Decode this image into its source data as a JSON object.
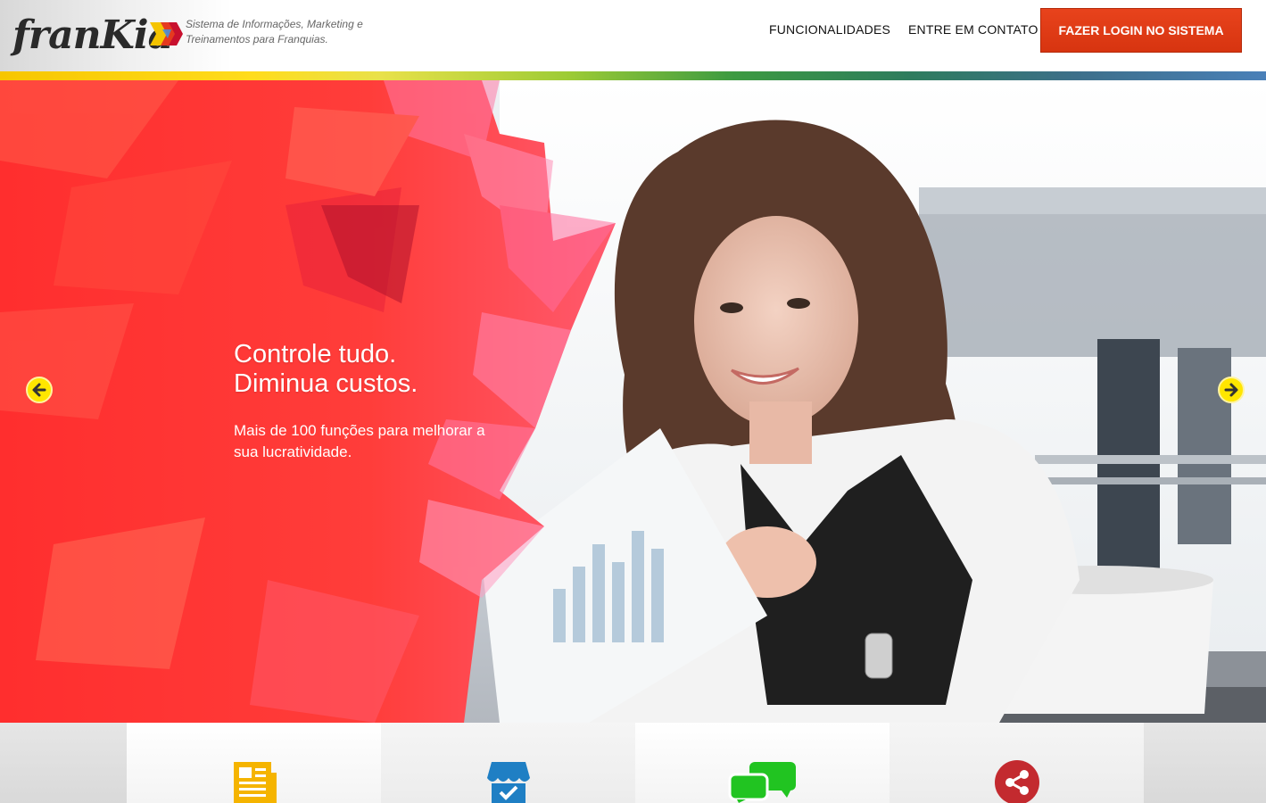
{
  "brand": {
    "logo_text": "franKia",
    "tagline": "Sistema de Informações, Marketing e Treinamentos para Franquias."
  },
  "nav": {
    "items": [
      {
        "label": "FUNCIONALIDADES"
      },
      {
        "label": "ENTRE EM CONTATO"
      }
    ],
    "login_label": "FAZER LOGIN NO SISTEMA"
  },
  "hero": {
    "title_line1": "Controle tudo.",
    "title_line2": "Diminua custos.",
    "subtitle": "Mais de 100 funções para melhorar a sua lucratividade.",
    "prev_icon": "arrow-left-icon",
    "next_icon": "arrow-right-icon"
  },
  "features": [
    {
      "icon": "newspaper-icon",
      "color": "#f5b400"
    },
    {
      "icon": "store-icon",
      "color": "#1f7fc4"
    },
    {
      "icon": "chat-icon",
      "color": "#21c421"
    },
    {
      "icon": "share-icon",
      "color": "#c32a2f"
    }
  ],
  "colors": {
    "login_button": "#e13b16",
    "hero_red": "#ff3b35",
    "arrow_yellow": "#ffe600"
  }
}
